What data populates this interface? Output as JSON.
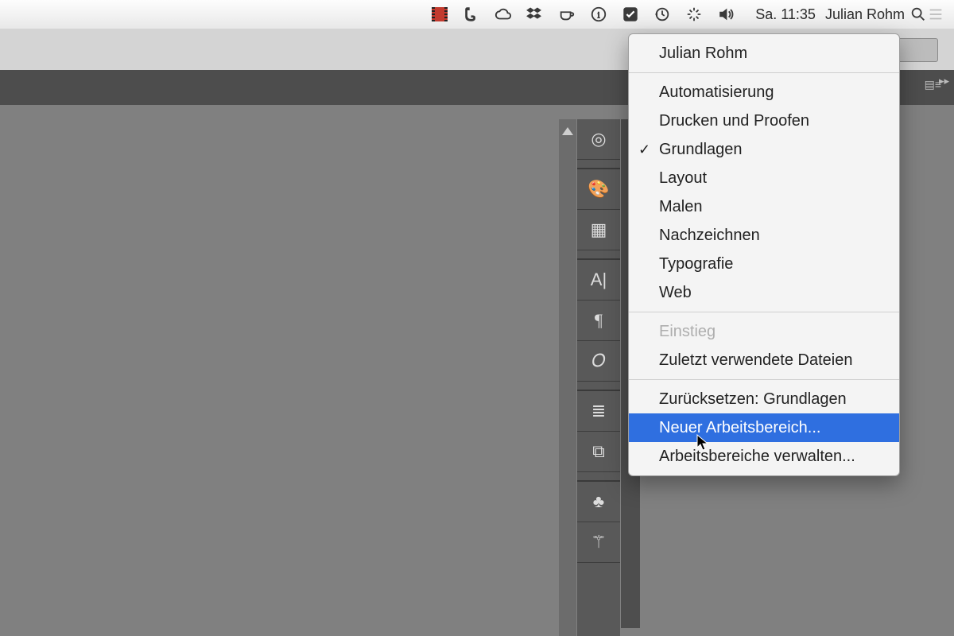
{
  "menubar": {
    "clock": "Sa. 11:35",
    "user": "Julian Rohm"
  },
  "workspace_menu": {
    "header": "Julian Rohm",
    "groups": [
      [
        "Automatisierung",
        "Drucken und Proofen",
        "Grundlagen",
        "Layout",
        "Malen",
        "Nachzeichnen",
        "Typografie",
        "Web"
      ],
      [
        "Einstieg",
        "Zuletzt verwendete Dateien"
      ],
      [
        "Zurücksetzen: Grundlagen",
        "Neuer Arbeitsbereich...",
        "Arbeitsbereiche verwalten..."
      ]
    ],
    "checked": "Grundlagen",
    "disabled": [
      "Einstieg"
    ],
    "highlighted": "Neuer Arbeitsbereich..."
  },
  "dock_icons": [
    "◎",
    "🎨",
    "▦",
    "A|",
    "¶",
    "𝑂",
    "≣",
    "⧉",
    "♣",
    "⚚"
  ]
}
